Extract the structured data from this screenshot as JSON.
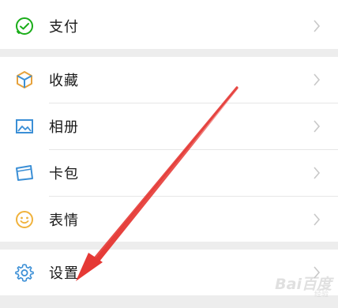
{
  "menu": {
    "pay": {
      "label": "支付",
      "icon": "wechat-pay-icon"
    },
    "favorites": {
      "label": "收藏",
      "icon": "cube-icon"
    },
    "album": {
      "label": "相册",
      "icon": "image-icon"
    },
    "wallet": {
      "label": "卡包",
      "icon": "card-icon"
    },
    "stickers": {
      "label": "表情",
      "icon": "smiley-icon"
    },
    "settings": {
      "label": "设置",
      "icon": "gear-icon"
    }
  },
  "watermark": {
    "main": "Bai百度",
    "sub": "经验"
  },
  "colors": {
    "pay_icon": "#1aad19",
    "favorites_icon": "#e6a23c",
    "album_icon": "#3b8fd6",
    "wallet_icon": "#3b8fd6",
    "stickers_icon": "#f0b23c",
    "settings_icon": "#3b8fd6",
    "arrow": "#e53935"
  }
}
